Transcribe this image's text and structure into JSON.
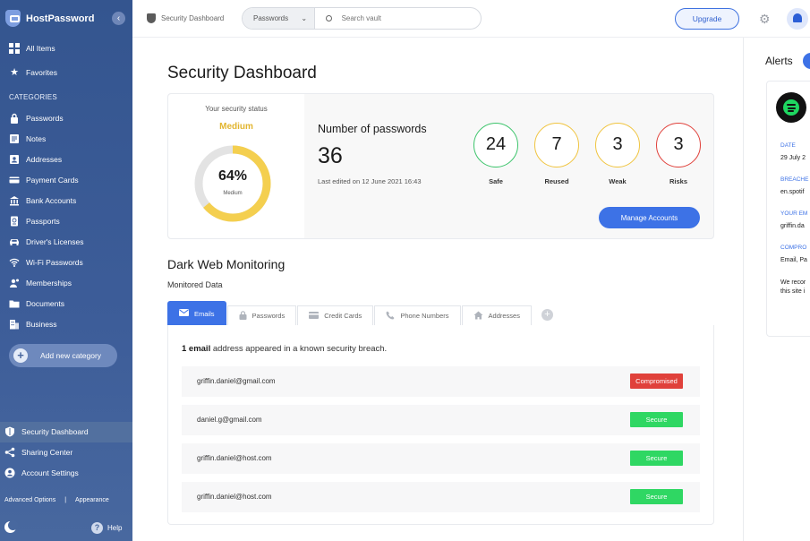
{
  "app": {
    "name": "HostPassword",
    "collapse_icon": "chevron-left-icon"
  },
  "sidebar": {
    "top_items": [
      {
        "label": "All Items",
        "icon": "grid-icon"
      },
      {
        "label": "Favorites",
        "icon": "star-icon"
      }
    ],
    "categories_title": "CATEGORIES",
    "categories": [
      {
        "label": "Passwords",
        "icon": "lock-icon"
      },
      {
        "label": "Notes",
        "icon": "note-icon"
      },
      {
        "label": "Addresses",
        "icon": "address-book-icon"
      },
      {
        "label": "Payment Cards",
        "icon": "credit-card-icon"
      },
      {
        "label": "Bank Accounts",
        "icon": "bank-icon"
      },
      {
        "label": "Passports",
        "icon": "passport-icon"
      },
      {
        "label": "Driver's Licenses",
        "icon": "car-icon"
      },
      {
        "label": "Wi-Fi Passwords",
        "icon": "wifi-icon"
      },
      {
        "label": "Memberships",
        "icon": "membership-icon"
      },
      {
        "label": "Documents",
        "icon": "folder-icon"
      },
      {
        "label": "Business",
        "icon": "building-icon"
      }
    ],
    "add_category": "Add new category",
    "bottom_items": [
      {
        "label": "Security Dashboard",
        "icon": "shield-icon"
      },
      {
        "label": "Sharing Center",
        "icon": "share-icon"
      },
      {
        "label": "Account Settings",
        "icon": "user-circle-icon"
      }
    ],
    "advanced_options": "Advanced Options",
    "separator": "|",
    "appearance": "Appearance",
    "help": "Help"
  },
  "topbar": {
    "breadcrumb": "Security Dashboard",
    "search_scope": "Passwords",
    "search_placeholder": "Search vault",
    "upgrade": "Upgrade"
  },
  "page": {
    "title": "Security Dashboard"
  },
  "security_status": {
    "label": "Your security status",
    "level": "Medium",
    "percent": 64,
    "percent_text": "64%",
    "sublabel": "Medium",
    "colors": {
      "ring": "#f4cf4f",
      "track": "#e3e3e3",
      "level_text": "#e2b52f"
    }
  },
  "passwords": {
    "label": "Number of passwords",
    "count": "36",
    "last_edited": "Last edited on 12 June 2021 16:43",
    "stats": [
      {
        "value": "24",
        "label": "Safe",
        "color": "#3cc46b"
      },
      {
        "value": "7",
        "label": "Reused",
        "color": "#f0c43f"
      },
      {
        "value": "3",
        "label": "Weak",
        "color": "#f0c43f"
      },
      {
        "value": "3",
        "label": "Risks",
        "color": "#e0413b"
      }
    ],
    "manage_button": "Manage Accounts"
  },
  "dark_web": {
    "title": "Dark Web Monitoring",
    "subtitle": "Monitored Data",
    "tabs": [
      {
        "label": "Emails",
        "icon": "envelope-icon",
        "active": true
      },
      {
        "label": "Passwords",
        "icon": "lock-icon",
        "active": false
      },
      {
        "label": "Credit Cards",
        "icon": "credit-card-icon",
        "active": false
      },
      {
        "label": "Phone Numbers",
        "icon": "phone-icon",
        "active": false
      },
      {
        "label": "Addresses",
        "icon": "home-icon",
        "active": false
      }
    ],
    "add_tab": "+",
    "breach_count_text": "1 email",
    "breach_rest_text": " address appeared in a known security breach.",
    "emails": [
      {
        "address": "griffin.daniel@gmail.com",
        "status": "Compromised",
        "color": "#e0413b"
      },
      {
        "address": "daniel.g@gmail.com",
        "status": "Secure",
        "color": "#2fd763"
      },
      {
        "address": "griffin.daniel@host.com",
        "status": "Secure",
        "color": "#2fd763"
      },
      {
        "address": "griffin.daniel@host.com",
        "status": "Secure",
        "color": "#2fd763"
      }
    ]
  },
  "alerts": {
    "title": "Alerts",
    "card": {
      "logo": "spotify-icon",
      "fields": [
        {
          "key": "DATE",
          "value": "29 July 2"
        },
        {
          "key": "BREACHE",
          "value": "en.spotif"
        },
        {
          "key": "YOUR EM",
          "value": "griffin.da"
        },
        {
          "key": "COMPRO",
          "value": "Email, Pa"
        }
      ],
      "note_line1": "We recor",
      "note_line2": "this site i"
    }
  },
  "colors": {
    "accent": "#3d72e6",
    "sidebar": "#3d5d99"
  }
}
